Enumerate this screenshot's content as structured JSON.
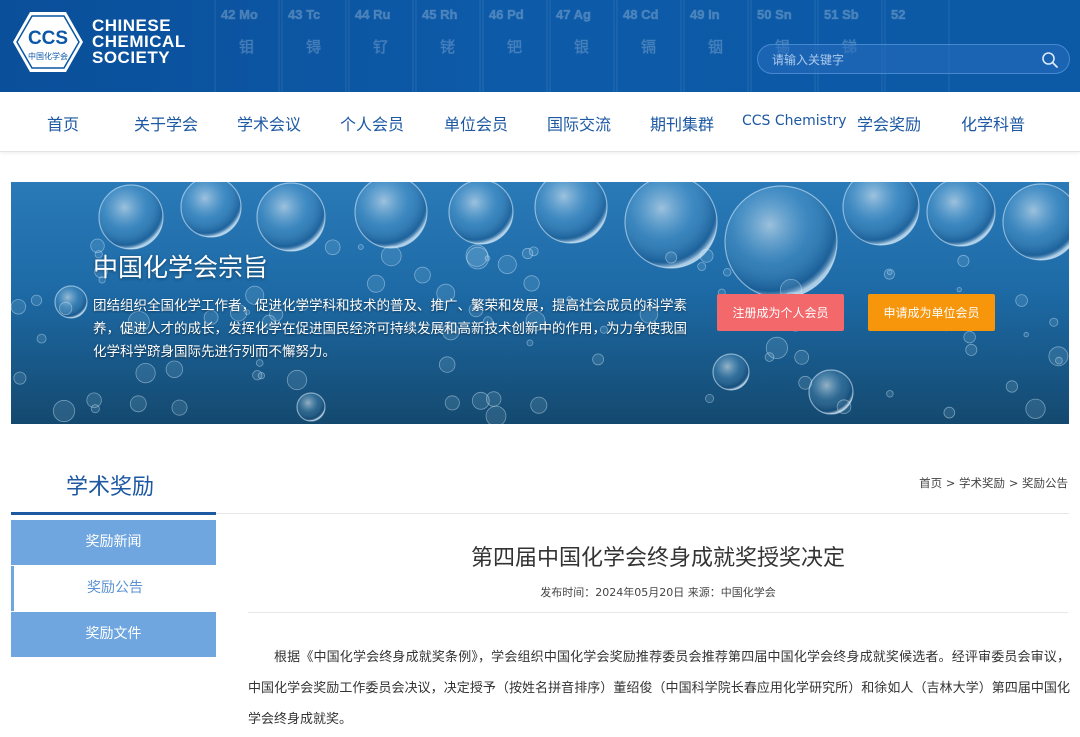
{
  "header": {
    "logo_abbr": "CCS",
    "logo_cn": "中国化学会",
    "logo_line1": "CHINESE",
    "logo_line2": "CHEMICAL",
    "logo_line3": "SOCIETY",
    "elements": [
      "42 Mo",
      "43 Tc",
      "44 Ru",
      "45 Rh",
      "46 Pd",
      "47 Ag",
      "48 Cd",
      "49 In",
      "50 Sn",
      "51 Sb",
      "52"
    ],
    "element_cn": [
      "钼",
      "锝",
      "钌",
      "铑",
      "钯",
      "银",
      "镉",
      "铟",
      "锡",
      "锑"
    ],
    "search_placeholder": "请输入关键字"
  },
  "nav": {
    "items": [
      "首页",
      "关于学会",
      "学术会议",
      "个人会员",
      "单位会员",
      "国际交流",
      "期刊集群",
      "CCS Chemistry",
      "学会奖励",
      "化学科普"
    ]
  },
  "banner": {
    "title": "中国化学会宗旨",
    "text": "团结组织全国化学工作者，促进化学学科和技术的普及、推广、繁荣和发展，提高社会成员的科学素养，促进人才的成长，发挥化学在促进国民经济可持续发展和高新技术创新中的作用，为力争使我国化学科学跻身国际先进行列而不懈努力。",
    "btn_individual": "注册成为个人会员",
    "btn_unit": "申请成为单位会员"
  },
  "sidebar": {
    "title": "学术奖励",
    "items": [
      "奖励新闻",
      "奖励公告",
      "奖励文件"
    ]
  },
  "breadcrumb": "首页 > 学术奖励 > 奖励公告",
  "article": {
    "title": "第四届中国化学会终身成就奖授奖决定",
    "meta": "发布时间：2024年05月20日 来源：中国化学会",
    "body": "根据《中国化学会终身成就奖条例》，学会组织中国化学会奖励推荐委员会推荐第四届中国化学会终身成就奖候选者。经评审委员会审议，中国化学会奖励工作委员会决议，决定授予（按姓名拼音排序）董绍俊（中国科学院长春应用化学研究所）和徐如人（吉林大学）第四届中国化学会终身成就奖。"
  },
  "colors": {
    "brand_blue": "#1d58a3",
    "header_blue": "#0c57a6",
    "sidebar_blue": "#6fa6df",
    "btn_red": "#f2686b",
    "btn_orange": "#f7950b"
  }
}
